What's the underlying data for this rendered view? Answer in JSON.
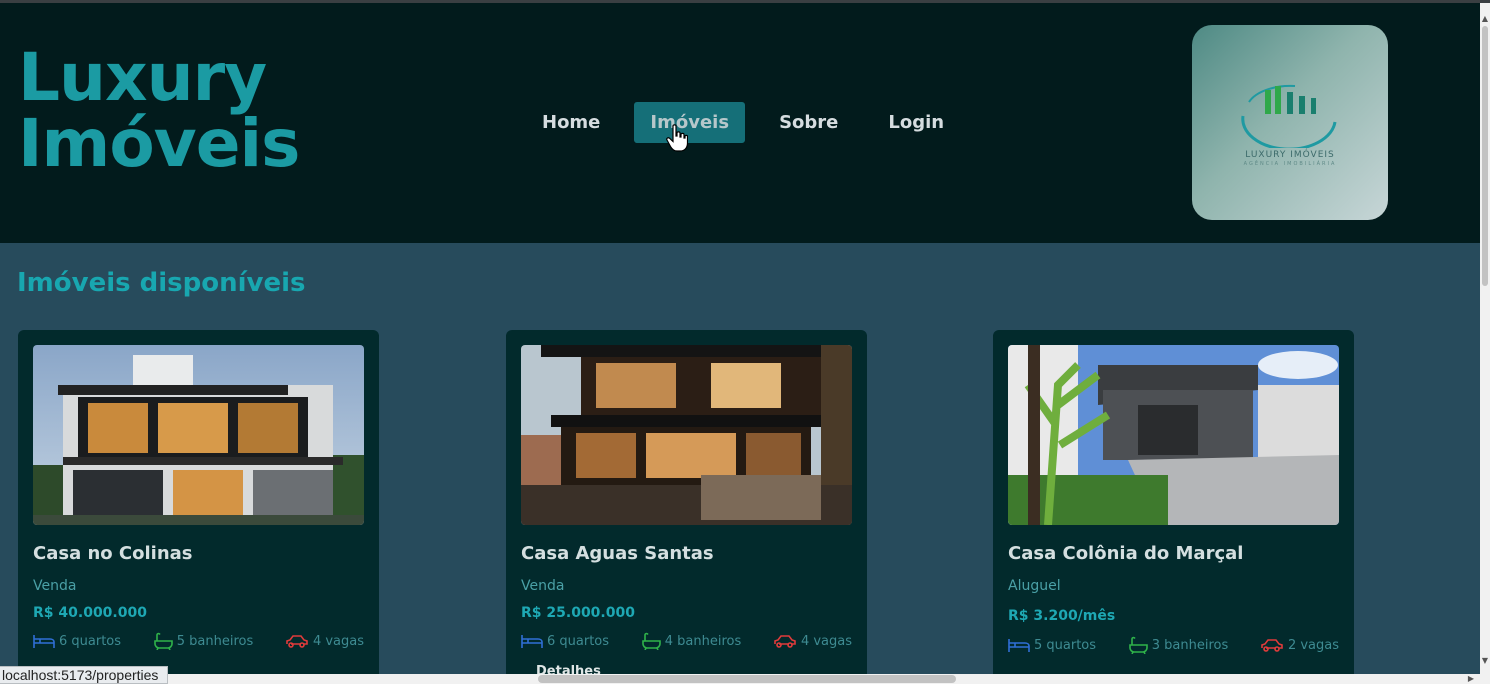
{
  "header": {
    "brand_line1": "Luxury",
    "brand_line2": "Imóveis",
    "nav": [
      {
        "label": "Home",
        "active": false
      },
      {
        "label": "Imóveis",
        "active": true
      },
      {
        "label": "Sobre",
        "active": false
      },
      {
        "label": "Login",
        "active": false
      }
    ],
    "logo_text": "LUXURY IMÓVEIS",
    "logo_sub": "AGÊNCIA IMOBILIÁRIA"
  },
  "main": {
    "section_title": "Imóveis disponíveis",
    "cards": [
      {
        "title": "Casa no Colinas",
        "type": "Venda",
        "price": "R$ 40.000.000",
        "rooms": "6 quartos",
        "baths": "5 banheiros",
        "parking": "4 vagas",
        "details": ""
      },
      {
        "title": "Casa Aguas Santas",
        "type": "Venda",
        "price": "R$ 25.000.000",
        "rooms": "6 quartos",
        "baths": "4 banheiros",
        "parking": "4 vagas",
        "details": "Detalhes"
      },
      {
        "title": "Casa Colônia do Marçal",
        "type": "Aluguel",
        "price": "R$ 3.200/mês",
        "rooms": "5 quartos",
        "baths": "3 banheiros",
        "parking": "2 vagas",
        "details": ""
      }
    ]
  },
  "status_bar": {
    "url": "localhost:5173/properties"
  },
  "colors": {
    "header_bg": "#021b1c",
    "page_bg": "#274b5c",
    "accent": "#1b9ba3",
    "card_bg": "#022a2c",
    "bed_icon": "#2f6fd6",
    "bath_icon": "#2fb34a",
    "car_icon": "#e03b3b"
  },
  "icons": [
    "bed-icon",
    "bathtub-icon",
    "car-icon",
    "hand-cursor-icon"
  ]
}
